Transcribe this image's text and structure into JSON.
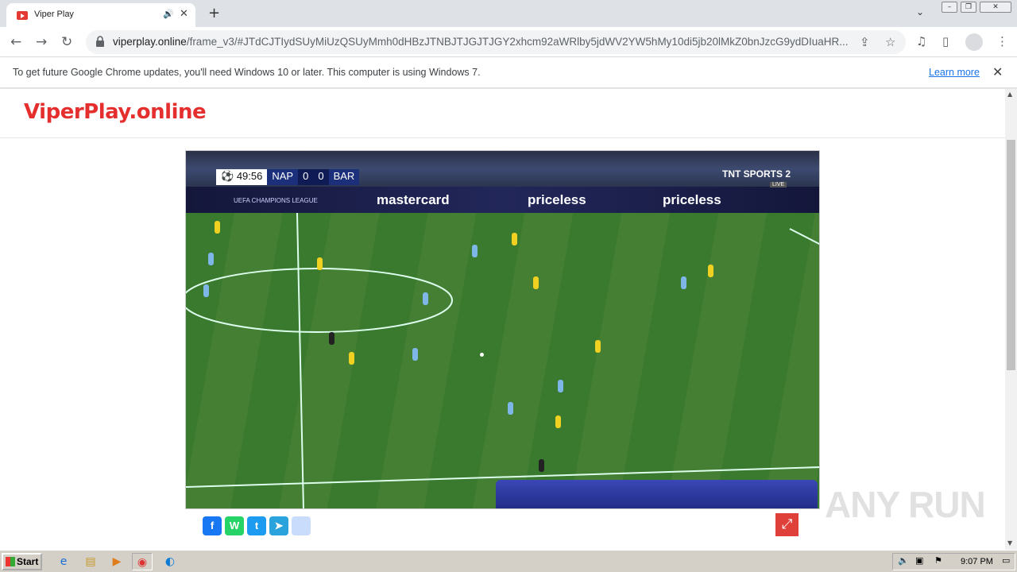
{
  "browser": {
    "tab_title": "Viper Play",
    "url_host": "viperplay.online",
    "url_path": "/frame_v3/#JTdCJTIydSUyMiUzQSUyMmh0dHBzJTNBJTJGJTJGY2xhcm92aWRlby5jdWV2YW5hMy10di5jb20lMkZ0bnJzcG9ydDIuaHR...",
    "infobar_text": "To get future Google Chrome updates, you'll need Windows 10 or later. This computer is using Windows 7.",
    "infobar_link": "Learn more"
  },
  "site": {
    "logo": "ViperPlay.online"
  },
  "video": {
    "clock": "49:56",
    "home_team": "NAP",
    "home_score": "0",
    "away_score": "0",
    "away_team": "BAR",
    "channel": "TNT SPORTS 2",
    "live_label": "LIVE",
    "board_text_1": "mastercard",
    "board_text_2": "priceless",
    "board_text_3": "priceless",
    "board_small": "UEFA CHAMPIONS LEAGUE"
  },
  "share": {
    "facebook": "f",
    "whatsapp": "W",
    "twitter": "t",
    "telegram": "➤",
    "more": ""
  },
  "taskbar": {
    "start_label": "Start",
    "clock": "9:07 PM"
  },
  "watermark": "ANY RUN",
  "colors": {
    "logo_red": "#e52e2e",
    "facebook": "#1877f2",
    "whatsapp": "#25d366",
    "twitter": "#1d9bf0",
    "telegram": "#2aa3dd",
    "fullscreen_button": "#e0403a"
  }
}
